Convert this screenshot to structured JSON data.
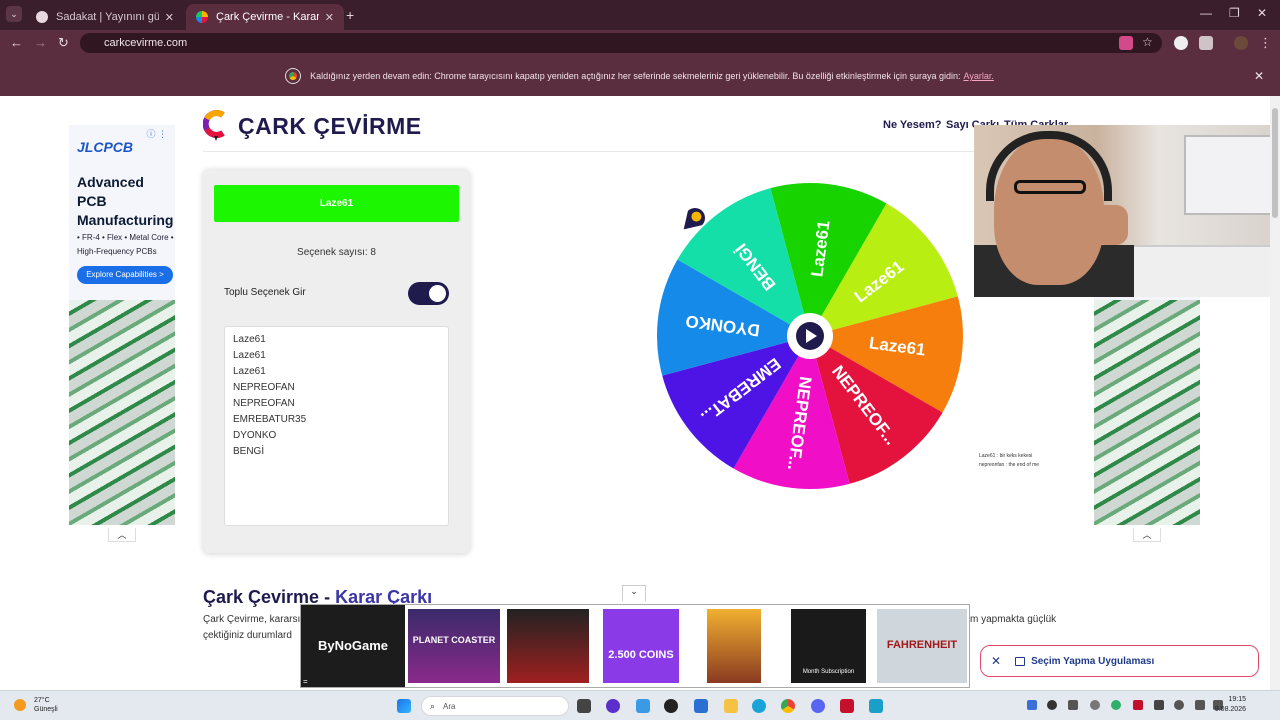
{
  "browser": {
    "tabs": [
      {
        "title": "Sadakat | Yayınını güçlendirmek",
        "active": false
      },
      {
        "title": "Çark Çevirme - Karar Çarkı",
        "active": true
      }
    ],
    "new_tab": "+",
    "url": "carkcevirme.com",
    "infobar": {
      "message": "Kaldığınız yerden devam edin: Chrome tarayıcısını kapatıp yeniden açtığınız her seferinde sekmeleriniz geri yüklenebilir. Bu özelliği etkinleştirmek için şuraya gidin:",
      "link": "Ayarlar."
    }
  },
  "site": {
    "title": "ÇARK ÇEVİRME",
    "nav": [
      "Ne Yesem?",
      "Sayı Çarkı",
      "Tüm Çarklar"
    ]
  },
  "panel": {
    "winner": "Laze61",
    "option_count": "Seçenek sayısı: 8",
    "bulk_label": "Toplu Seçenek Gir",
    "bulk_enabled": true,
    "options": [
      "Laze61",
      "Laze61",
      "Laze61",
      "NEPREOFAN",
      "NEPREOFAN",
      "EMREBATUR35",
      "DYONKO",
      "BENGİ"
    ]
  },
  "wheel": {
    "segments": [
      {
        "label": "Laze61",
        "color": "#17d400"
      },
      {
        "label": "Laze61",
        "color": "#b9ee12"
      },
      {
        "label": "Laze61",
        "color": "#f67e0c"
      },
      {
        "label": "NEPREOF...",
        "color": "#e3133e"
      },
      {
        "label": "NEPREOF...",
        "color": "#f00ec6"
      },
      {
        "label": "EMREBAT...",
        "color": "#4e14e6"
      },
      {
        "label": "DYONKO",
        "color": "#168ae9"
      },
      {
        "label": "BENGİ",
        "color": "#14dfa8"
      }
    ]
  },
  "ads": {
    "brand": "JLCPCB",
    "headline": "Advanced PCB Manufacturing",
    "features": "• FR-4  • Flex  • Metal Core  • High-Frequency PCBs",
    "cta": "Explore Capabilities >"
  },
  "article": {
    "heading_start": "Çark Çevirme - ",
    "heading_highlight": "Karar Çarkı",
    "line1": "Çark Çevirme, kararsız",
    "line2": "çektiğiniz durumlard",
    "line3_end": "m yapmakta güçlük"
  },
  "overlay": {
    "line1": "Laze61 : bir keks kekesi",
    "line2": "nepreonfan : the end of me"
  },
  "adbar": {
    "brand": "ByNoGame",
    "tiles": [
      "PLANET COASTER",
      "",
      "2.500 COINS",
      "",
      "Month Subscription",
      "FAHRENHEIT"
    ]
  },
  "toast": {
    "label": "Seçim Yapma Uygulaması"
  },
  "taskbar": {
    "temp": "27°C",
    "weather": "Güneşli",
    "search": "Ara",
    "time": "19:15",
    "date": "9.08.2026"
  },
  "colors": {
    "accent": "#1f1b4d",
    "winner": "#1cf700",
    "chrome_dark": "#3a1e2b"
  }
}
